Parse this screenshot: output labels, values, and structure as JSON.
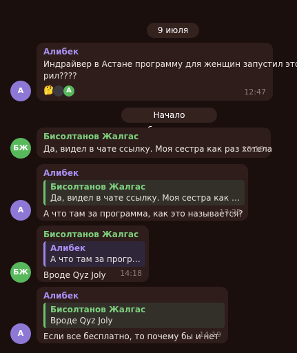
{
  "date_pill": "9 июля",
  "thread_pill": "Начало обсуждения",
  "messages": [
    {
      "sender": "Алибек",
      "avatar": "А",
      "text_line1": "Индрайвер в Астане программу для женщин запустил это",
      "text_line2": "рил????",
      "time": "12:47",
      "reactions": [
        {
          "icon": "thinking-face-emoji",
          "glyph": "🤔"
        },
        {
          "icon": "reactor-avatar-dark",
          "glyph": ""
        },
        {
          "icon": "reactor-avatar-green",
          "glyph": "A"
        }
      ]
    },
    {
      "sender": "Бисолтанов Жалгас",
      "avatar": "БЖ",
      "text": "Да, видел в чате ссылку. Моя сестра как раз хотела",
      "time": "13:18"
    },
    {
      "sender": "Алибек",
      "avatar": "А",
      "quote_sender": "Бисолтанов Жалгас",
      "quote_text": "Да, видел в чате ссылку. Моя сестра как раз хоте...",
      "text": "А что там за программа, как это называется?",
      "time": "13:25"
    },
    {
      "sender": "Бисолтанов Жалгас",
      "avatar": "БЖ",
      "quote_sender": "Алибек",
      "quote_text": "А что там за програм...",
      "text": "Вроде Qyz Joly",
      "time": "14:18"
    },
    {
      "sender": "Алибек",
      "avatar": "А",
      "quote_sender": "Бисолтанов Жалгас",
      "quote_text": "Вроде Qyz Joly",
      "text": "Если все бесплатно, то почему бы и нет",
      "time": "14:19"
    }
  ],
  "colors": {
    "background": "#1b0f0e",
    "bubble": "#2e1d1b",
    "name_purple": "#a88ff0",
    "name_green": "#7ed07e"
  }
}
